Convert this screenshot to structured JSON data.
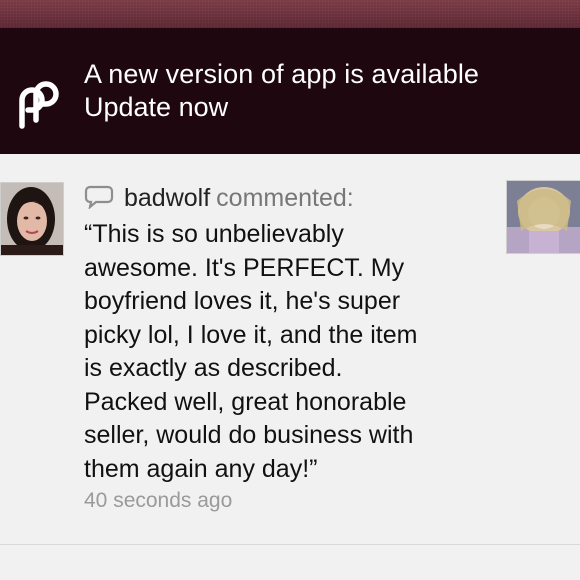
{
  "notification": {
    "title": "A new version of app is available",
    "action": "Update now",
    "logo_icon": "app-logo-icon"
  },
  "comment": {
    "username": "badwolf",
    "verb": "commented:",
    "text": "“This is so unbelievably\nawesome. It's PERFECT. My\nboyfriend loves it, he's super\npicky lol, I love it, and the item\nis exactly as described.\nPacked well, great honorable\nseller, would do business with\nthem again any day!”",
    "timestamp": "40 seconds ago",
    "bubble_icon": "comment-bubble-icon"
  },
  "colors": {
    "banner_bg": "#1f0710",
    "top_strip": "#6b303c",
    "feed_bg": "#f1f1f1"
  }
}
